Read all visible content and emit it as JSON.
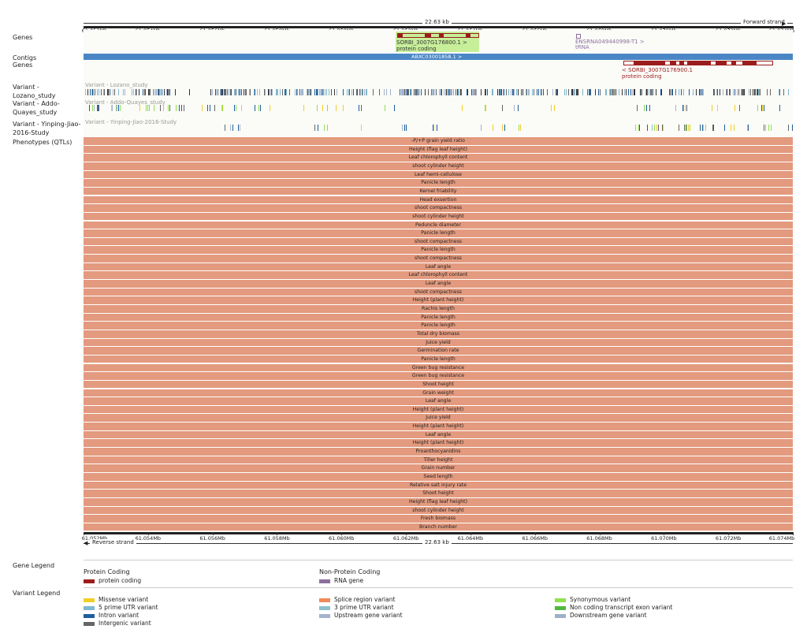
{
  "ruler": {
    "length": "22.63 kb",
    "forward_strand": "Forward strand",
    "reverse_strand": "Reverse strand",
    "ticks": [
      "61.052Mb",
      "61.054Mb",
      "61.056Mb",
      "61.058Mb",
      "61.060Mb",
      "61.062Mb",
      "61.064Mb",
      "61.066Mb",
      "61.068Mb",
      "61.070Mb",
      "61.072Mb",
      "61.074Mb"
    ]
  },
  "tracks": {
    "genes": "Genes",
    "contigs": "Contigs",
    "genes2": "Genes",
    "variant_lozano": "Variant - Lozano_study",
    "variant_addo": "Variant - Addo-Quayes_study",
    "variant_yinping": "Variant - Yinping-Jiao-2016-Study",
    "phenotypes": "Phenotypes (QTLs)"
  },
  "genes": {
    "gene1_id": "SORBI_3007G176800.1 >",
    "gene1_type": "protein coding",
    "gene2_id": "ENSRNA049440998-T1 >",
    "gene2_type": "tRNA",
    "gene3_id": "< SORBI_3007G176900.1",
    "gene3_type": "protein coding",
    "contig": "ABXC03001858.1 >"
  },
  "variant_track_titles": {
    "lozano": "Variant - Lozano_study",
    "addo": "Variant - Addo-Quayes_study",
    "yinping": "Variant - Yinping-Jiao-2016-Study"
  },
  "qtls": [
    "-P/+P grain yield ratio",
    "Height (flag leaf height)",
    "Leaf chlorophyll content",
    "shoot cylinder height",
    "Leaf hemi-cellulose",
    "Panicle length",
    "Kernel friability",
    "Head exsertion",
    "shoot compactness",
    "shoot cylinder height",
    "Peduncle diameter",
    "Panicle length",
    "shoot compactness",
    "Panicle length",
    "shoot compactness",
    "Leaf angle",
    "Leaf chlorophyll content",
    "Leaf angle",
    "shoot compactness",
    "Height (plant height)",
    "Rachis length",
    "Panicle length",
    "Panicle length",
    "Total dry biomass",
    "Juice yield",
    "Germination rate",
    "Panicle length",
    "Green bug resistance",
    "Green bug resistance",
    "Shoot height",
    "Grain weight",
    "Leaf angle",
    "Height (plant height)",
    "Juice yield",
    "Height (plant height)",
    "Leaf angle",
    "Height (plant height)",
    "Proanthocyanidins",
    "Tiller height",
    "Grain number",
    "Seed length",
    "Relative salt injury rate",
    "Shoot height",
    "Height (flag leaf height)",
    "shoot cylinder height",
    "Fresh biomass",
    "Branch number"
  ],
  "gene_legend": {
    "title": "Gene Legend",
    "protein_coding_header": "Protein Coding",
    "protein_coding_item": "protein coding",
    "non_protein_coding_header": "Non-Protein Coding",
    "rna_gene_item": "RNA gene"
  },
  "variant_legend": {
    "title": "Variant Legend",
    "items": [
      {
        "label": "Missense variant",
        "color": "#f0d028"
      },
      {
        "label": "5 prime UTR variant",
        "color": "#7fb8d0"
      },
      {
        "label": "Intron variant",
        "color": "#1f5e9e"
      },
      {
        "label": "Intergenic variant",
        "color": "#666666"
      },
      {
        "label": "Splice region variant",
        "color": "#f08a5a"
      },
      {
        "label": "3 prime UTR variant",
        "color": "#8fc0cc"
      },
      {
        "label": "Upstream gene variant",
        "color": "#a4b4cc"
      },
      {
        "label": "Synonymous variant",
        "color": "#90e050"
      },
      {
        "label": "Non coding transcript exon variant",
        "color": "#50b83c"
      },
      {
        "label": "Downstream gene variant",
        "color": "#a0b0c8"
      }
    ]
  },
  "colors": {
    "protein_coding": "#9b1c1c",
    "rna_gene": "#8b6f9c",
    "contig": "#4a86c5",
    "qtl": "#e39a7e",
    "gene_highlight": "#c7ef9a"
  }
}
